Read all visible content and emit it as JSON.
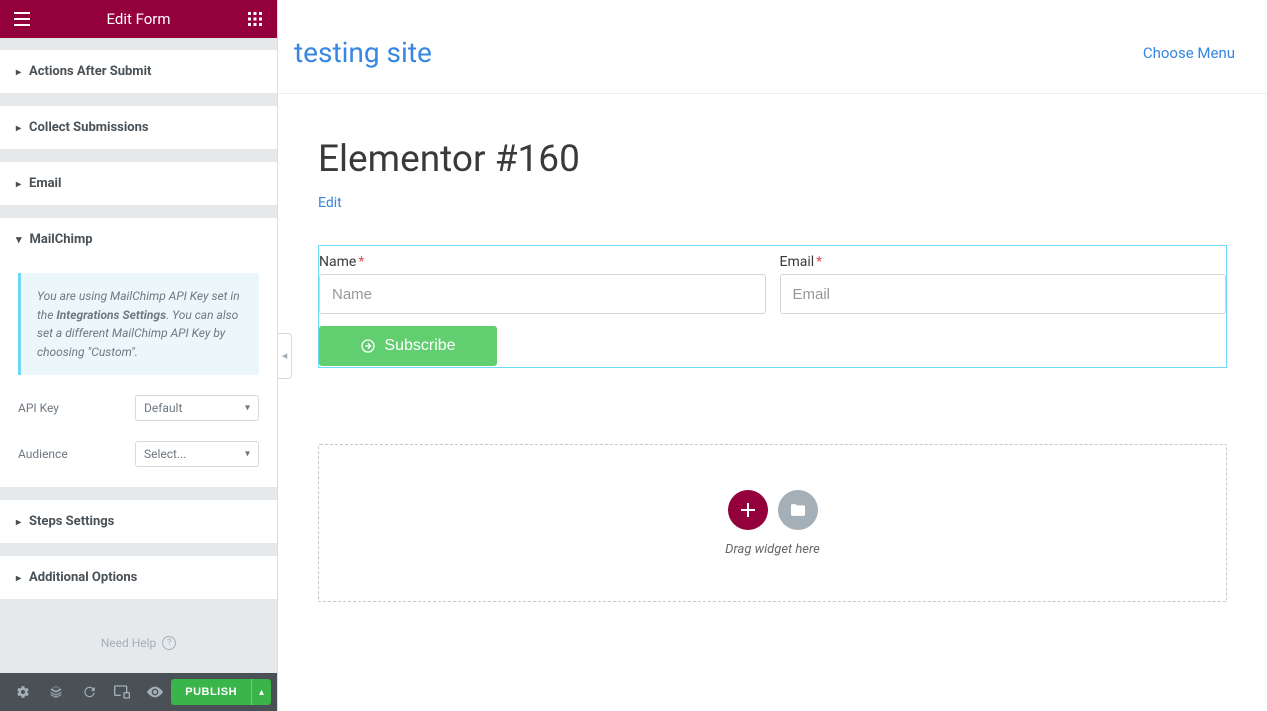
{
  "sidebar": {
    "title": "Edit Form",
    "sections": {
      "actions_after_submit": {
        "label": "Actions After Submit"
      },
      "collect_submissions": {
        "label": "Collect Submissions"
      },
      "email": {
        "label": "Email"
      },
      "mailchimp": {
        "label": "MailChimp",
        "info_pre": "You are using MailChimp API Key set in the ",
        "info_bold": "Integrations Settings",
        "info_post": ". You can also set a different MailChimp API Key by choosing \"Custom\".",
        "api_key": {
          "label": "API Key",
          "value": "Default"
        },
        "audience": {
          "label": "Audience",
          "value": "Select..."
        }
      },
      "steps_settings": {
        "label": "Steps Settings"
      },
      "additional_options": {
        "label": "Additional Options"
      }
    },
    "help": "Need Help",
    "publish": "PUBLISH"
  },
  "preview": {
    "site_title": "testing site",
    "choose_menu": "Choose Menu",
    "page_title": "Elementor #160",
    "edit_link": "Edit",
    "form": {
      "name_label": "Name",
      "name_placeholder": "Name",
      "email_label": "Email",
      "email_placeholder": "Email",
      "subscribe": "Subscribe"
    },
    "drop_zone": {
      "text": "Drag widget here"
    }
  }
}
